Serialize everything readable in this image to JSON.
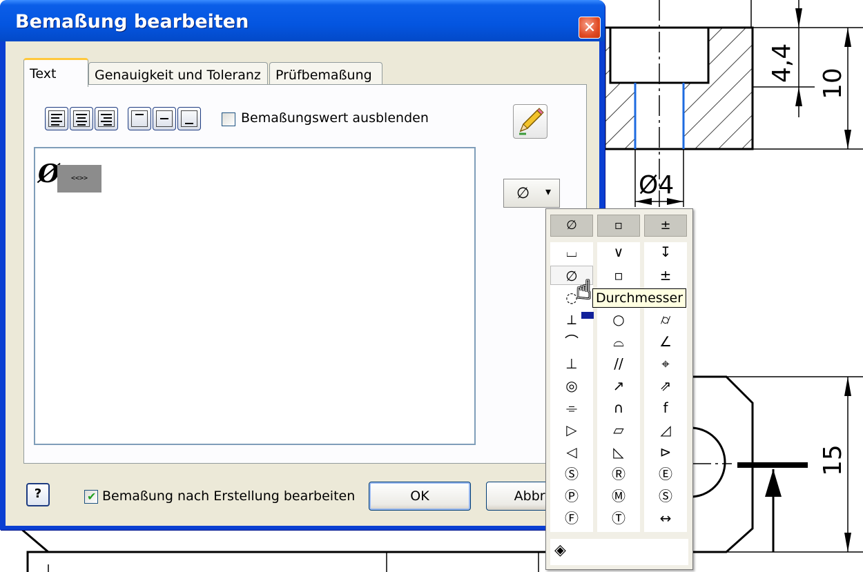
{
  "dialog": {
    "title": "Bemaßung bearbeiten",
    "close_glyph": "✕",
    "tabs": [
      {
        "label": "Text",
        "active": true
      },
      {
        "label": "Genauigkeit und Toleranz",
        "active": false
      },
      {
        "label": "Prüfbemaßung",
        "active": false
      }
    ],
    "hide_value_checkbox": {
      "label": "Bemaßungswert ausblenden",
      "checked": false
    },
    "edit_text": {
      "symbol": "Ø",
      "placeholder_token": "<<>>"
    },
    "symbol_button": {
      "symbol": "∅",
      "arrow": "▾"
    },
    "edit_after_create_checkbox": {
      "label": "Bemaßung nach Erstellung bearbeiten",
      "checked": true
    },
    "help_label": "?",
    "ok_label": "OK",
    "cancel_label": "Abbrec"
  },
  "palette": {
    "header": [
      "∅",
      "▫",
      "±"
    ],
    "columns": [
      [
        "⌴",
        "∅",
        "◌",
        "⟂",
        "⌒",
        "⊥",
        "◎",
        "⌯",
        "▷",
        "◁",
        "Ⓢ",
        "Ⓟ",
        "Ⓕ"
      ],
      [
        "∨",
        "▫",
        "",
        "○",
        "⌓",
        "//",
        "↗",
        "∩",
        "▱",
        "◺",
        "Ⓡ",
        "Ⓜ",
        "Ⓣ"
      ],
      [
        "↧",
        "±",
        "",
        "⌭",
        "∠",
        "⌖",
        "⇗",
        "f",
        "◿",
        "⊳",
        "Ⓔ",
        "Ⓢ",
        "↔"
      ]
    ],
    "tooltip": "Durchmesser",
    "footer_icon": "◈"
  },
  "drawing": {
    "dimensions": [
      "4,4",
      "10",
      "Ø4",
      "15"
    ]
  }
}
